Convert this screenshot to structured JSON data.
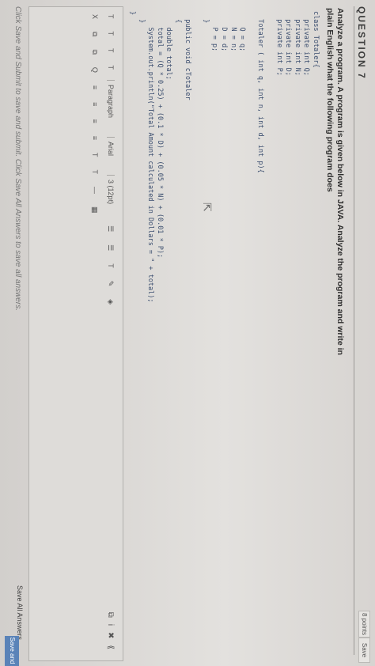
{
  "question": {
    "heading": "QUESTION 7",
    "points": "8 points",
    "save_label": "Save",
    "prompt": "Analyze a program. A program is given below in JAVA. Analyze the program and write in plain English what the following program does"
  },
  "code_lines": [
    "class Totaler{",
    "  private int Q;",
    "  private int N;",
    "  private int D;",
    "  private int P;",
    "",
    "  Totaler ( int q, int n, int d, int p){",
    "",
    "    Q = q;",
    "    N = n;",
    "    D = d;",
    "    P = p;",
    "  }",
    "",
    "  public void cTotaler",
    "  {",
    "    double total;",
    "    total = (Q * 0.25) + (0.1 * D) + (0.05 * N) + (0.01 * P);",
    "    System.out.println(\"Total Amount calculated in Dollars = \" + total);",
    "  }",
    "}"
  ],
  "editor": {
    "row1": [
      "T",
      "T",
      "T",
      "T",
      "Paragraph",
      "Arial",
      "3 (12pt)",
      "☰",
      "☰",
      "T",
      "✎",
      "◈"
    ],
    "row2": [
      "X",
      "⧉",
      "⧉",
      "Q",
      "≡",
      "≡",
      "≡",
      "≡",
      "T",
      "T",
      "—",
      "▦"
    ],
    "right_icons": [
      "⧉",
      "i",
      "✖",
      "⟪"
    ]
  },
  "footer": {
    "note": "Click Save and Submit to save and submit. Click Save All Answers to save all answers.",
    "save_all": "Save All Answers",
    "save_submit": "Save and Submit"
  }
}
